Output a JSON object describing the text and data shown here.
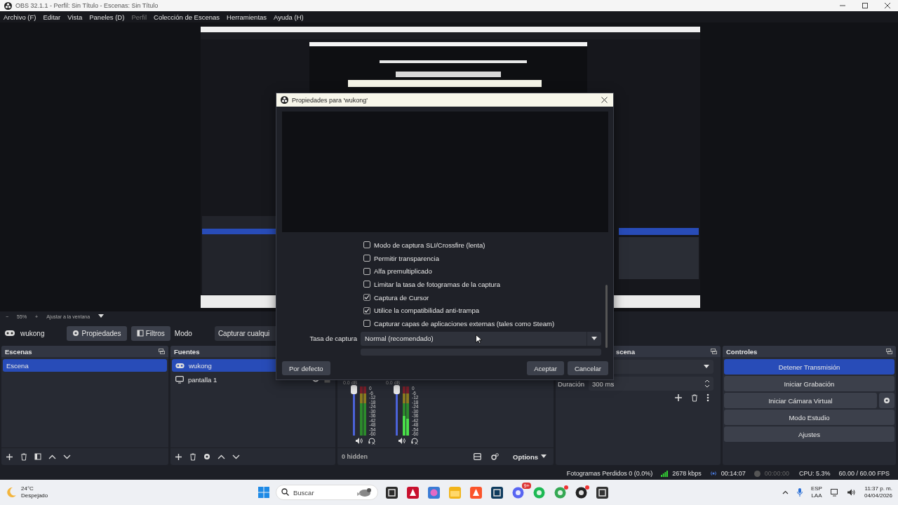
{
  "window": {
    "title": "OBS 32.1.1 - Perfil: Sin Título - Escenas: Sin Título"
  },
  "menu": [
    {
      "label": "Archivo (F)",
      "disabled": false
    },
    {
      "label": "Editar",
      "disabled": false
    },
    {
      "label": "Vista",
      "disabled": false
    },
    {
      "label": "Paneles (D)",
      "disabled": false
    },
    {
      "label": "Perfil",
      "disabled": true
    },
    {
      "label": "Colección de Escenas",
      "disabled": false
    },
    {
      "label": "Herramientas",
      "disabled": false
    },
    {
      "label": "Ayuda (H)",
      "disabled": false
    }
  ],
  "zoom_bar": {
    "minus": "−",
    "zoom": "55%",
    "plus": "+",
    "fit": "Ajustar a la ventana"
  },
  "source_toolbar": {
    "source": "wukong",
    "properties": "Propiedades",
    "filters": "Filtros",
    "mode_label": "Modo",
    "mode_value": "Capturar cualqui"
  },
  "scenes": {
    "title": "Escenas",
    "items": [
      {
        "label": "Escena",
        "selected": true
      }
    ]
  },
  "sources": {
    "title": "Fuentes",
    "items": [
      {
        "label": "wukong",
        "kind": "game",
        "selected": true
      },
      {
        "label": "pantalla 1",
        "kind": "display",
        "selected": false,
        "visible": true,
        "locked": false
      }
    ]
  },
  "mixer": {
    "channels": [
      {
        "db": "0.0 dB",
        "level": 1,
        "scale": [
          "0",
          "-6",
          "-12",
          "-18",
          "-24",
          "-30",
          "-36",
          "-42",
          "-48",
          "-54",
          "-60"
        ]
      },
      {
        "db": "0.0 dB",
        "level": 1,
        "scale": [
          "0",
          "-6",
          "-12",
          "-18",
          "-24",
          "-30",
          "-36",
          "-42",
          "-48",
          "-54",
          "-60"
        ]
      }
    ],
    "hidden": "0 hidden",
    "options": "Options"
  },
  "transitions": {
    "title": "scena",
    "duration_label": "Duración",
    "duration": "300 ms"
  },
  "controls": {
    "title": "Controles",
    "buttons": [
      {
        "label": "Detener Transmisión",
        "active": true
      },
      {
        "label": "Iniciar Grabación",
        "active": false
      },
      {
        "label": "Iniciar Cámara Virtual",
        "active": false
      },
      {
        "label": "Modo Estudio",
        "active": false
      },
      {
        "label": "Ajustes",
        "active": false
      }
    ]
  },
  "status_bar": {
    "dropped": "Fotogramas Perdidos 0 (0.0%)",
    "bitrate": "2678 kbps",
    "stream_time": "00:14:07",
    "rec_time": "00:00:00",
    "cpu": "CPU: 5.3%",
    "fps": "60.00 / 60.00 FPS"
  },
  "dialog": {
    "title": "Propiedades para 'wukong'",
    "options": [
      {
        "label": "Modo de captura SLI/Crossfire (lenta)",
        "checked": false
      },
      {
        "label": "Permitir transparencia",
        "checked": false
      },
      {
        "label": "Alfa premultiplicado",
        "checked": false
      },
      {
        "label": "Limitar la tasa de fotogramas de la captura",
        "checked": false
      },
      {
        "label": "Captura de Cursor",
        "checked": true
      },
      {
        "label": "Utilice la compatibilidad anti-trampa",
        "checked": true
      },
      {
        "label": "Capturar capas de aplicaciones externas (tales como Steam)",
        "checked": false
      }
    ],
    "rate_label": "Tasa de captura",
    "rate_value": "Normal (recomendado)",
    "defaults": "Por defecto",
    "ok": "Aceptar",
    "cancel": "Cancelar"
  },
  "taskbar": {
    "temp": "24°C",
    "weather": "Despejado",
    "search_placeholder": "Buscar",
    "badge": "9+",
    "lang": "ESP",
    "layout": "LAA",
    "time": "11:37 p. m.",
    "date": "04/04/2026"
  }
}
